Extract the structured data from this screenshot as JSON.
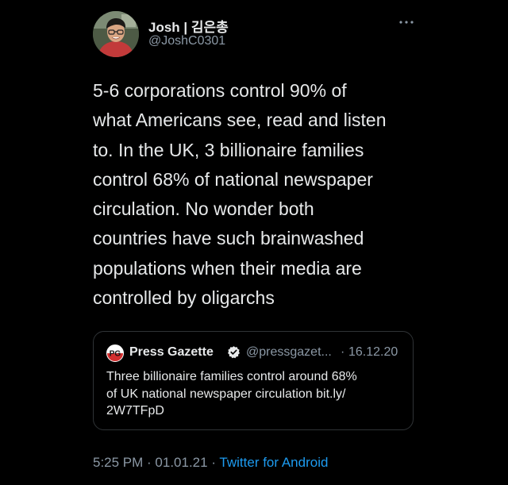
{
  "author": {
    "name": "Josh | 김은총",
    "handle": "@JoshC0301"
  },
  "tweet": {
    "text": "5-6 corporations control 90% of\nwhat Americans see, read and listen\nto. In the UK, 3 billionaire families\ncontrol 68% of national newspaper\ncirculation. No wonder both\ncountries have such brainwashed\npopulations when their media are\ncontrolled by oligarchs"
  },
  "quoted_tweet": {
    "name": "Press Gazette",
    "handle": "@pressgazet...",
    "separator": "·",
    "date": "16.12.20",
    "text": "Three billionaire families control around 68%\nof UK national newspaper circulation bit.ly/\n2W7TFpD",
    "logo_text": "PG"
  },
  "meta": {
    "time": "5:25 PM",
    "separator_1": " · ",
    "date": "01.01.21",
    "separator_2": " · ",
    "source": "Twitter for Android"
  },
  "icons": {
    "more": "more-horizontal-icon",
    "verified": "verified-badge-icon"
  },
  "colors": {
    "background": "#000000",
    "text": "#e7e9ea",
    "secondary": "#8b98a5",
    "link": "#1d9bf0",
    "border": "#2f3336"
  }
}
